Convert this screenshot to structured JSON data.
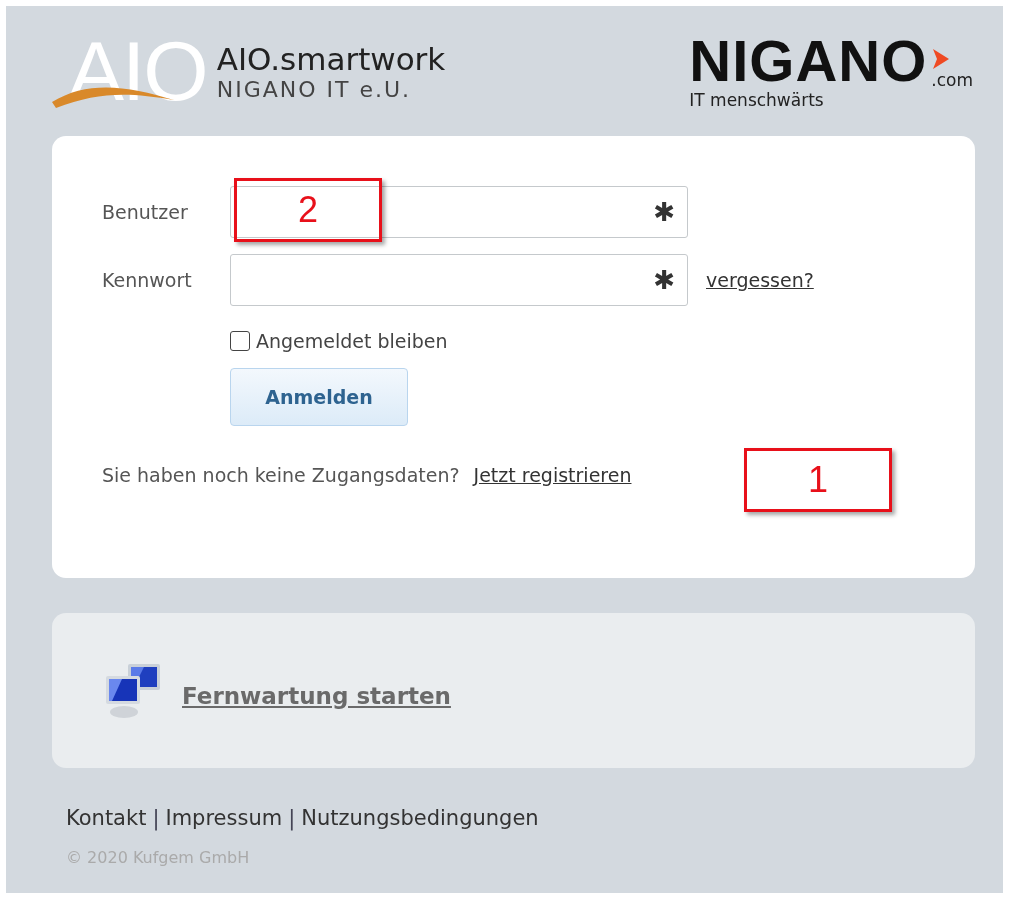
{
  "header": {
    "logo_mark": "AIO",
    "product": "AIO.smartwork",
    "company": "NIGANO IT e.U.",
    "partner_logo": {
      "name": "NIGANO",
      "suffix": ".com",
      "tagline": "IT menschwärts"
    }
  },
  "login": {
    "fields": [
      {
        "label": "Benutzer",
        "required_mark": "✱",
        "callout": "2"
      },
      {
        "label": "Kennwort",
        "required_mark": "✱",
        "link": "vergessen?"
      }
    ],
    "remember": {
      "label": "Angemeldet bleiben",
      "checked": false
    },
    "submit": "Anmelden",
    "register": {
      "text": "Sie haben noch keine Zugangsdaten?",
      "link": "Jetzt registrieren",
      "callout": "1"
    }
  },
  "remote": {
    "link": "Fernwartung starten"
  },
  "footer": {
    "links": [
      "Kontakt",
      "Impressum",
      "Nutzungsbedingungen"
    ],
    "separator": "|",
    "copyright": "© 2020 Kufgem GmbH"
  }
}
